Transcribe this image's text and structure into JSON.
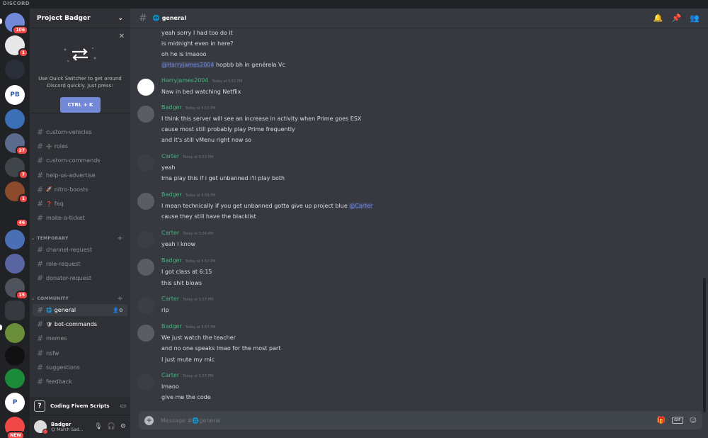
{
  "window": {
    "title": "DISCORD"
  },
  "guilds": [
    {
      "label": "",
      "badge": "106",
      "color": "#7289da",
      "icon": "discord-home-icon"
    },
    {
      "label": "",
      "badge": "1",
      "color": "#e8e8e8",
      "icon": "guild-avatar"
    },
    {
      "label": "",
      "badge": "",
      "color": "#2a2f3a",
      "icon": "guild-avatar"
    },
    {
      "label": "PB",
      "badge": "",
      "color": "#ffffff",
      "icon": "project-badger-logo"
    },
    {
      "label": "",
      "badge": "",
      "color": "#3b6fb6",
      "icon": "guild-avatar"
    },
    {
      "label": "",
      "badge": "27",
      "color": "#5b6b8c",
      "icon": "guild-folder"
    },
    {
      "label": "",
      "badge": "7",
      "color": "#40444b",
      "icon": "guild-folder"
    },
    {
      "label": "",
      "badge": "1",
      "color": "#8b4a2b",
      "icon": "guild-avatar"
    },
    {
      "label": "",
      "badge": "46",
      "color": "#202225",
      "icon": "guild-folder"
    },
    {
      "label": "",
      "badge": "",
      "color": "#4a6fb5",
      "icon": "guild-folder"
    },
    {
      "label": "",
      "badge": "",
      "color": "#5865a0",
      "icon": "guild-folder"
    },
    {
      "label": "",
      "badge": "15",
      "color": "#4f545c",
      "icon": "guild-folder"
    },
    {
      "label": "",
      "badge": "",
      "color": "#36393f",
      "icon": "folder-icon"
    },
    {
      "label": "",
      "badge": "",
      "color": "#6b8e3a",
      "icon": "guild-avatar"
    },
    {
      "label": "",
      "badge": "",
      "color": "#111111",
      "icon": "guild-avatar"
    },
    {
      "label": "",
      "badge": "",
      "color": "#1b8a3a",
      "icon": "guild-avatar"
    },
    {
      "label": "P",
      "badge": "",
      "color": "#ffffff",
      "icon": "guild-avatar"
    },
    {
      "label": "",
      "badge": "NEW",
      "color": "#f04747",
      "icon": "guild-avatar"
    }
  ],
  "server": {
    "name": "Project Badger"
  },
  "quick_switcher": {
    "text": "Use Quick Switcher to get around Discord quickly. Just press:",
    "shortcut": "CTRL + K"
  },
  "channels_top": [
    {
      "name": "custom-vehicles",
      "emoji": ""
    },
    {
      "name": "roles",
      "emoji": "➕"
    },
    {
      "name": "custom-commands",
      "emoji": ""
    },
    {
      "name": "help-us-advertise",
      "emoji": ""
    },
    {
      "name": "nitro-boosts",
      "emoji": "🚀"
    },
    {
      "name": "faq",
      "emoji": "❓"
    },
    {
      "name": "make-a-ticket",
      "emoji": ""
    }
  ],
  "category_temporary": "TEMPORARY",
  "channels_temporary": [
    {
      "name": "channel-request"
    },
    {
      "name": "role-request"
    },
    {
      "name": "donator-request"
    }
  ],
  "category_community": "COMMUNITY",
  "channels_community": [
    {
      "name": "general",
      "emoji": "🌐",
      "state": "active"
    },
    {
      "name": "bot-commands",
      "emoji": "🛡",
      "state": "unread"
    },
    {
      "name": "memes",
      "emoji": "",
      "state": ""
    },
    {
      "name": "nsfw",
      "emoji": "",
      "state": ""
    },
    {
      "name": "suggestions",
      "emoji": "",
      "state": ""
    },
    {
      "name": "feedback",
      "emoji": "",
      "state": ""
    }
  ],
  "voice_bar": {
    "icon": "?",
    "title": "Coding Fivem Scripts"
  },
  "user": {
    "name": "Badger",
    "status": "😊 March Sad..."
  },
  "chat": {
    "channel": "general",
    "composer_placeholder": "Message #🌐general"
  },
  "messages": [
    {
      "author": "",
      "time": "",
      "lines": [
        "yeah sorry I had too do it",
        "is midnight even in here?",
        "oh he is lmaooo"
      ]
    },
    {
      "author": "",
      "time": "",
      "mention": "@Harryjames2004",
      "after": " hopbb bh in genérela Vc"
    },
    {
      "author": "Harryjames2004",
      "time": "Today at 5:52 PM",
      "lines": [
        "Naw in bed watching Netflix"
      ]
    },
    {
      "author": "Badger",
      "time": "Today at 5:53 PM",
      "lines": [
        "I think this server will see an increase in activity when Prime goes ESX",
        "cause most still probably play Prime frequently",
        "and it's still vMenu right now so"
      ]
    },
    {
      "author": "Carter",
      "time": "Today at 5:53 PM",
      "lines": [
        "yeah",
        "Ima play this if i get unbanned i'll play both"
      ]
    },
    {
      "author": "Badger",
      "time": "Today at 5:56 PM",
      "lines": [
        "I mean technically if you get unbanned gotta give up project blue",
        "cause they still have the blacklist"
      ],
      "mention": "@Carter"
    },
    {
      "author": "Carter",
      "time": "Today at 5:56 PM",
      "lines": [
        "yeah i know"
      ]
    },
    {
      "author": "Badger",
      "time": "Today at 5:57 PM",
      "lines": [
        "I got class at 6:15",
        "this shit blows"
      ]
    },
    {
      "author": "Carter",
      "time": "Today at 5:57 PM",
      "lines": [
        "rip"
      ]
    },
    {
      "author": "Badger",
      "time": "Today at 5:57 PM",
      "lines": [
        "We just watch the teacher",
        "and no one speaks lmao for the most part",
        "I just mute my mic"
      ]
    },
    {
      "author": "Carter",
      "time": "Today at 5:57 PM",
      "lines": [
        "lmaoo",
        "give me the code"
      ]
    }
  ],
  "colors": {
    "accent": "#7289da",
    "author": "#43b581",
    "danger": "#f04747"
  }
}
